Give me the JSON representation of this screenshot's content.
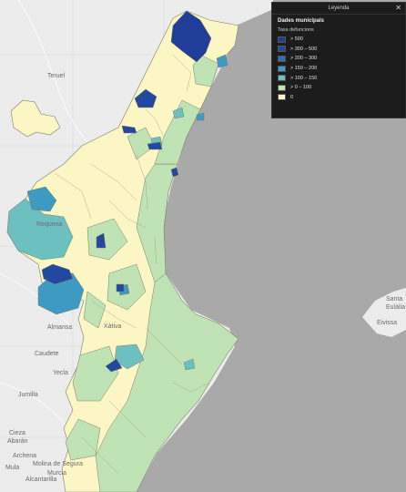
{
  "legend": {
    "title": "Leyenda",
    "close_icon": "close-icon",
    "layer_title": "Dades municipals",
    "field_title": "Taxa defuncions",
    "classes": [
      {
        "label": "> 500",
        "color": "#1f3d99"
      },
      {
        "label": "> 300 – 500",
        "color": "#22489f"
      },
      {
        "label": "> 200 – 300",
        "color": "#2d6db3"
      },
      {
        "label": "> 150 – 200",
        "color": "#3d9ac2"
      },
      {
        "label": "> 100 – 150",
        "color": "#6dc0c0"
      },
      {
        "label": "> 0 – 100",
        "color": "#bfe3b4"
      },
      {
        "label": "0",
        "color": "#fbf6c4"
      }
    ]
  },
  "map_labels": {
    "teruel": "Teruel",
    "requena": "Requena",
    "albacete_region": "Almansa",
    "caudete": "Caudete",
    "yecla": "Yecla",
    "jumilla": "Jumilla",
    "cieza": "Cieza",
    "abaran": "Abarán",
    "archena": "Archena",
    "molina": "Molina de Segura",
    "murcia": "Murcia",
    "alcantarilla": "Alcantarilla",
    "mula": "Mula",
    "santa": "Santa",
    "eulalia": "Eulàlia",
    "ibiza": "Eivissa",
    "xativa": "Xàtiva"
  },
  "colors": {
    "sea": "#a9a9a9",
    "land": "#ececec",
    "region_border": "#7d7d6a"
  }
}
